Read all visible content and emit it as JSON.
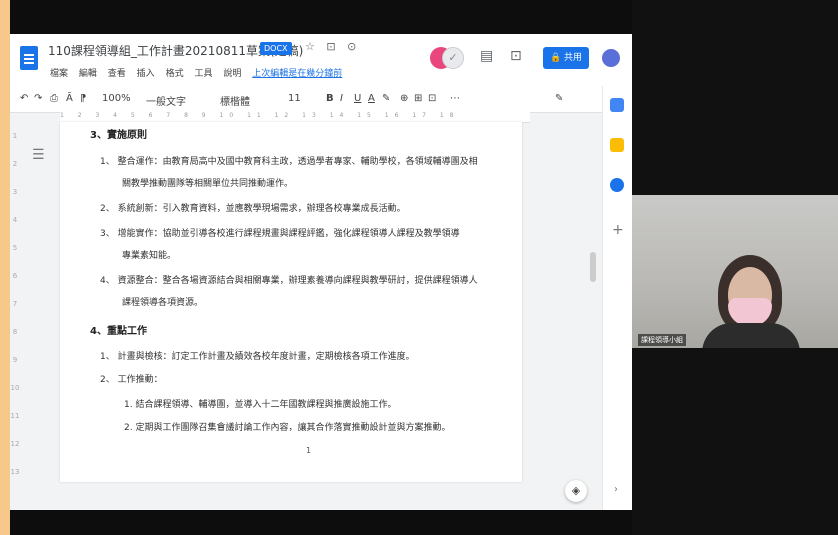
{
  "document": {
    "title": "110課程領導組_工作計畫20210811草案(定稿)",
    "badge": "DOCX",
    "title_icons": "☆ ⊡ ⊙",
    "menu": [
      "檔案",
      "編輯",
      "查看",
      "插入",
      "格式",
      "工具",
      "說明"
    ],
    "last_edit": "上次編輯是在幾分鐘前",
    "share_label": "共用"
  },
  "toolbar": {
    "undo": "↶",
    "redo": "↷",
    "print": "⎙",
    "spell": "Ā",
    "paint": "⁋",
    "zoom": "100%",
    "style": "一般文字",
    "font": "標楷體",
    "font_size": "11",
    "bold": "B",
    "italic": "I",
    "underline": "U",
    "text_color": "A",
    "highlight": "✎",
    "link": "⊕",
    "comment": "⊞",
    "image": "⊡",
    "more": "⋯",
    "edit_mode": "✎"
  },
  "content": {
    "section_3_heading": "3、實施原則",
    "lines": [
      "1、 整合運作：由教育局高中及國中教育科主政，透過學者專家、輔助學校，各領域輔導團及相",
      "關教學推動團隊等相關單位共同推動運作。",
      "2、 系統創新：引入教育資料，並應教學現場需求，辦理各校專業成長活動。",
      "3、 增能實作：協助並引導各校進行課程規畫與課程評鑑，強化課程領導人課程及教學領導",
      "專業素知能。",
      "4、 資源整合：整合各場資源結合與相關專業，辦理素養導向課程與教學研討，提供課程領導人",
      "課程領導各項資源。"
    ],
    "section_4_heading": "4、重點工作",
    "work_lines": [
      "1、 計畫與檢核：訂定工作計畫及績效各校年度計畫，定期檢核各項工作進度。",
      "2、 工作推動："
    ],
    "sub_lines": [
      "1. 結合課程領導、輔導團，並導入十二年國教課程與推廣設施工作。",
      "2. 定期與工作團隊召集會議討論工作內容，讓其合作落實推動設計並與方案推動。"
    ],
    "page_number": "1"
  },
  "video": {
    "name_label": "課程領導小組"
  },
  "icons": {
    "doc": "docs-icon",
    "share": "lock-icon",
    "account": "account-icon",
    "calendar": "calendar-icon",
    "keep": "keep-icon",
    "tasks": "tasks-icon",
    "add": "plus-icon",
    "explore": "explore-icon",
    "expand": "chevron-right-icon",
    "outline": "outline-icon"
  },
  "colors": {
    "accent": "#1a73e8",
    "keep": "#fbbc04",
    "tasks": "#1a73e8",
    "calendar": "#4285f4"
  }
}
